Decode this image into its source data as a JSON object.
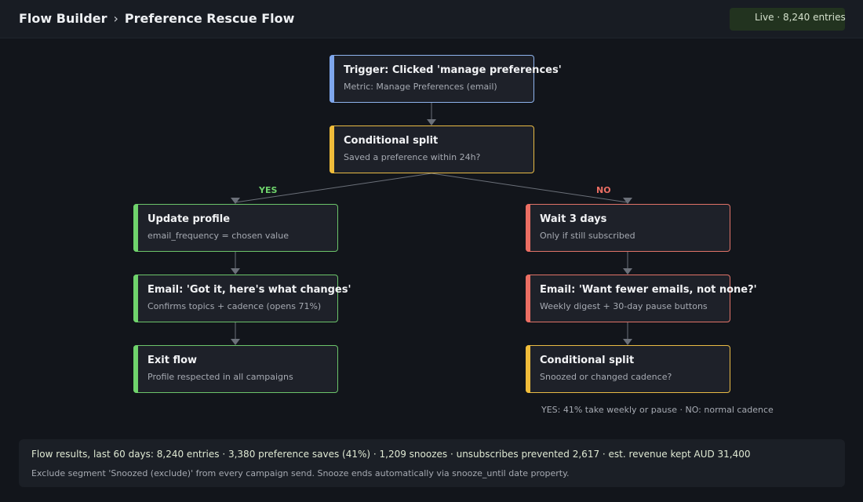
{
  "header": {
    "breadcrumb_root": "Flow Builder",
    "breadcrumb_separator": "›",
    "flow_name": "Preference Rescue Flow",
    "status_badge": "Live · 8,240 entries"
  },
  "nodes": {
    "trigger": {
      "title": "Trigger: Clicked 'manage preferences'",
      "subtitle": "Metric: Manage Preferences (email)"
    },
    "split_main": {
      "title": "Conditional split",
      "subtitle": "Saved a preference within 24h?"
    },
    "update_profile": {
      "title": "Update profile",
      "subtitle": "email_frequency = chosen value"
    },
    "email_got_it": {
      "title": "Email: 'Got it, here's what changes'",
      "subtitle": "Confirms topics + cadence (opens 71%)"
    },
    "exit_flow": {
      "title": "Exit flow",
      "subtitle": "Profile respected in all campaigns"
    },
    "wait": {
      "title": "Wait 3 days",
      "subtitle": "Only if still subscribed"
    },
    "email_fewer": {
      "title": "Email: 'Want fewer emails, not none?'",
      "subtitle": "Weekly digest + 30-day pause buttons"
    },
    "split_second": {
      "title": "Conditional split",
      "subtitle": "Snoozed or changed cadence?"
    }
  },
  "branches": {
    "yes": "YES",
    "no": "NO"
  },
  "split_note": "YES: 41% take weekly or pause  ·  NO: normal cadence",
  "footer": {
    "stats": "Flow results, last 60 days:  8,240 entries  ·  3,380 preference saves (41%)  ·  1,209 snoozes  ·  unsubscribes prevented 2,617  ·  est. revenue kept AUD 31,400",
    "hint": "Exclude segment 'Snoozed (exclude)' from every campaign send. Snooze ends automatically via snooze_until date property."
  },
  "colors": {
    "trigger": "#7ea6ec",
    "split": "#f0bc3a",
    "yes_branch": "#6fd36c",
    "no_branch": "#eb6e63",
    "connector": "#6b7079"
  }
}
